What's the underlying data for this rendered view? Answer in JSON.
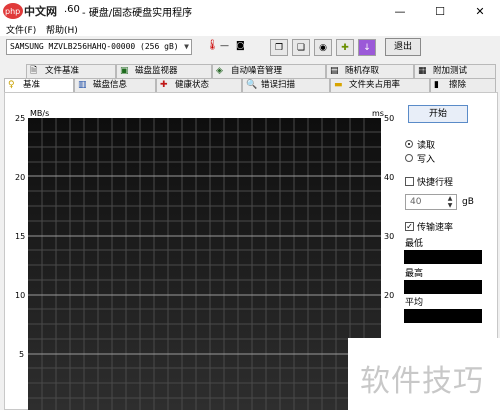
{
  "window": {
    "title_prefix": ".60",
    "title": "- 硬盘/固态硬盘实用程序",
    "logo_text": "php中文网",
    "controls": {
      "minimize": "—",
      "maximize": "☐",
      "close": "✕"
    }
  },
  "menu": {
    "items": [
      "文件(F)",
      "帮助(H)"
    ]
  },
  "toolbar": {
    "drive": "SAMSUNG MZVLB256HAHQ-00000 (256 gB)",
    "temp_value": "— ",
    "exit_label": "退出",
    "icons": [
      "thermometer-icon",
      "copy-icon",
      "copy2-icon",
      "camera-icon",
      "puzzle-icon",
      "download-icon"
    ]
  },
  "tabs_top": [
    {
      "label": "文件基准",
      "icon": "file-benchmark-icon"
    },
    {
      "label": "磁盘监视器",
      "icon": "disk-monitor-icon"
    },
    {
      "label": "自动噪音管理",
      "icon": "noise-icon"
    },
    {
      "label": "随机存取",
      "icon": "random-access-icon"
    },
    {
      "label": "附加测试",
      "icon": "extra-tests-icon"
    }
  ],
  "tabs_bottom": [
    {
      "label": "基准",
      "icon": "benchmark-icon"
    },
    {
      "label": "磁盘信息",
      "icon": "disk-info-icon"
    },
    {
      "label": "健康状态",
      "icon": "health-icon"
    },
    {
      "label": "错误扫描",
      "icon": "error-scan-icon"
    },
    {
      "label": "文件夹占用率",
      "icon": "folder-usage-icon"
    },
    {
      "label": "擦除",
      "icon": "erase-icon"
    }
  ],
  "chart": {
    "y_unit_left": "MB/s",
    "y_unit_right": "ms",
    "left_ticks": [
      "25",
      "20",
      "15",
      "10",
      "5"
    ],
    "right_ticks": [
      "50",
      "40",
      "30",
      "20"
    ]
  },
  "side": {
    "start_label": "开始",
    "read_label": "读取",
    "write_label": "写入",
    "short_stroke_label": "快捷行程",
    "stroke_value": "40",
    "stroke_unit": "gB",
    "transfer_rate_label": "传输速率",
    "min_label": "最低",
    "max_label": "最高",
    "avg_label": "平均"
  },
  "watermark": {
    "text": "软件技巧"
  }
}
